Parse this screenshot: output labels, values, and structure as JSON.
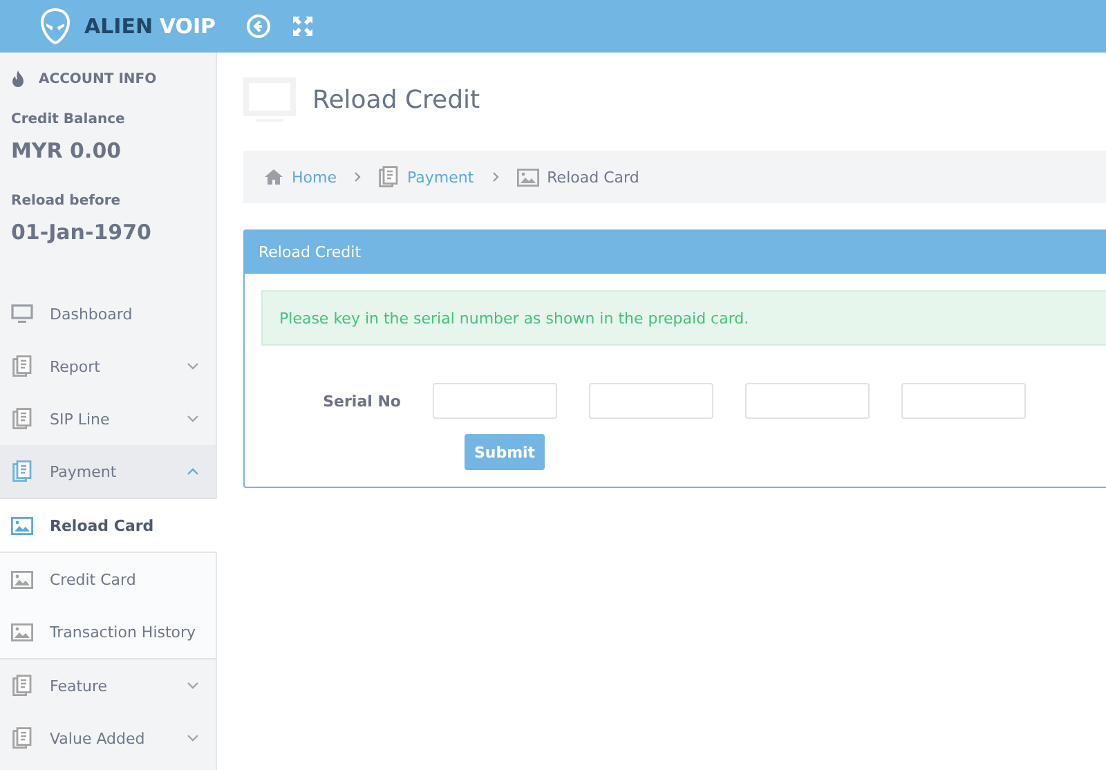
{
  "brand": {
    "first": "ALIEN",
    "second": "VOIP"
  },
  "account": {
    "title": "ACCOUNT INFO",
    "balance_label": "Credit Balance",
    "balance": "MYR 0.00",
    "reload_label": "Reload before",
    "reload_date": "01-Jan-1970"
  },
  "nav": [
    {
      "label": "Dashboard",
      "kind": "page"
    },
    {
      "label": "Report",
      "kind": "group",
      "expanded": false
    },
    {
      "label": "SIP Line",
      "kind": "group",
      "expanded": false
    },
    {
      "label": "Payment",
      "kind": "group",
      "expanded": true,
      "children": [
        {
          "label": "Reload Card",
          "selected": true
        },
        {
          "label": "Credit Card",
          "selected": false
        },
        {
          "label": "Transaction History",
          "selected": false
        }
      ]
    },
    {
      "label": "Feature",
      "kind": "group",
      "expanded": false
    },
    {
      "label": "Value Added",
      "kind": "group",
      "expanded": false
    }
  ],
  "page_title": "Reload Credit",
  "breadcrumb": [
    {
      "label": "Home",
      "kind": "home"
    },
    {
      "label": "Payment",
      "kind": "section"
    },
    {
      "label": "Reload Card",
      "kind": "current"
    }
  ],
  "panel": {
    "title": "Reload Credit",
    "notice": "Please key in the serial number as shown in the prepaid card.",
    "field_label": "Serial No",
    "button": "Submit"
  }
}
